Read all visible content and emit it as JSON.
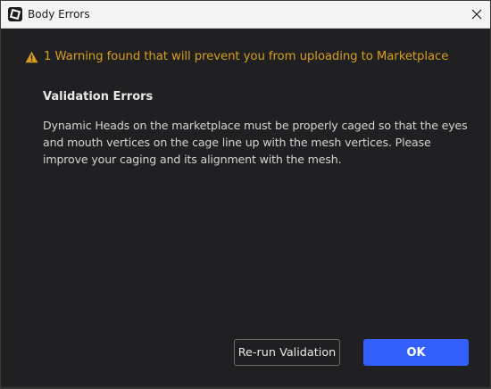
{
  "window": {
    "title": "Body Errors",
    "app_icon": "roblox-studio-icon",
    "close_icon": "close-icon"
  },
  "dialog": {
    "warning_icon": "warning-triangle-icon",
    "warning_text": "1 Warning found that will prevent you from uploading to Marketplace",
    "section_title": "Validation Errors",
    "message": "Dynamic Heads on the marketplace must be properly caged so that the eyes and mouth vertices on the cage line up with the mesh vertices. Please improve your caging and its alignment with the mesh."
  },
  "buttons": {
    "rerun_label": "Re-run Validation",
    "ok_label": "OK"
  },
  "colors": {
    "background": "#202023",
    "warning": "#d69e1e",
    "primary": "#335fff",
    "titlebar": "#f3f3f3"
  }
}
